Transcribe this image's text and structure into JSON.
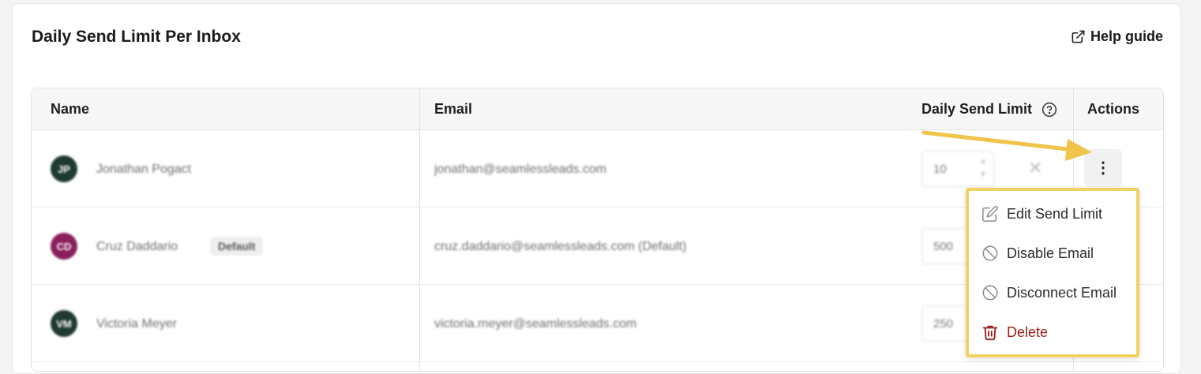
{
  "card": {
    "title": "Daily Send Limit Per Inbox",
    "help_label": "Help guide"
  },
  "table": {
    "columns": {
      "name": "Name",
      "email": "Email",
      "limit": "Daily Send Limit",
      "actions": "Actions"
    },
    "rows": [
      {
        "initials": "JP",
        "name": "Jonathan Pogact",
        "badge": "",
        "email": "jonathan@seamlessleads.com",
        "limit": "10",
        "avatar_color": "#1f3a33"
      },
      {
        "initials": "CD",
        "name": "Cruz Daddario",
        "badge": "Default",
        "email": "cruz.daddario@seamlessleads.com (Default)",
        "limit": "500",
        "avatar_color": "#8a1f5e"
      },
      {
        "initials": "VM",
        "name": "Victoria Meyer",
        "badge": "",
        "email": "victoria.meyer@seamlessleads.com",
        "limit": "250",
        "avatar_color": "#1f3a33"
      }
    ]
  },
  "menu": {
    "items": [
      {
        "label": "Edit Send Limit",
        "icon": "edit-icon"
      },
      {
        "label": "Disable Email",
        "icon": "ban-icon"
      },
      {
        "label": "Disconnect Email",
        "icon": "ban-icon"
      },
      {
        "label": "Delete",
        "icon": "trash-icon"
      }
    ]
  },
  "colors": {
    "highlight": "#f2d164",
    "delete": "#9b1c1c",
    "arrow": "#f0c44a"
  }
}
